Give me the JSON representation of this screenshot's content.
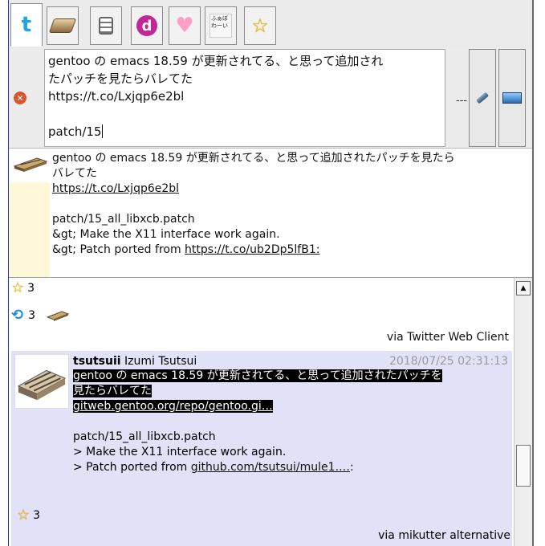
{
  "tabs": [
    {
      "name": "home-timeline",
      "icon": "twitter-icon",
      "active": true
    },
    {
      "name": "server",
      "icon": "server-icon"
    },
    {
      "name": "list",
      "icon": "list-icon"
    },
    {
      "name": "d-app",
      "icon": "d-icon"
    },
    {
      "name": "favorites-heart",
      "icon": "heart-icon"
    },
    {
      "name": "handwriting",
      "icon": "handwriting-icon",
      "label": "ふぁぼ わーい"
    },
    {
      "name": "favorites-star",
      "icon": "star-icon"
    }
  ],
  "compose": {
    "text_line1": "gentoo の emacs 18.59 が更新されてる、と思って追加され",
    "text_line2": "たパッチを見たらバレてた",
    "text_line3": "https://t.co/Lxjqp6e2bl",
    "text_line4": "",
    "text_line5": "patch/15",
    "counter": "---"
  },
  "reply_preview": {
    "line1": "gentoo の emacs 18.59 が更新されてる、と思って追加されたパッチを見たら",
    "line2": "バレてた",
    "link1": "https://t.co/Lxjqp6e2bl",
    "line4": "patch/15_all_libxcb.patch",
    "line5": "&gt; Make the X11 interface work again.",
    "line6_prefix": "&gt; Patch ported from ",
    "link2": "https://t.co/ub2Dp5lfB1:"
  },
  "tweet1": {
    "favorites": "3",
    "retweets": "3",
    "via": "via Twitter Web Client"
  },
  "tweet2": {
    "screen_name": "tsutsuii",
    "display_name": "Izumi Tsutsui",
    "timestamp": "2018/07/25 02:31:13",
    "line1": "gentoo の emacs 18.59 が更新されてる、と思って追加されたパッチを",
    "line2": "見たらバレてた",
    "link1": "gitweb.gentoo.org/repo/gentoo.gi…",
    "line4": "patch/15_all_libxcb.patch",
    "line5": "> Make the X11 interface work again.",
    "line6_prefix": "> Patch ported from ",
    "link2": "github.com/tsutsui/mule1.…",
    "line6_suffix": ":",
    "favorites": "3",
    "via": "via mikutter alternative"
  }
}
